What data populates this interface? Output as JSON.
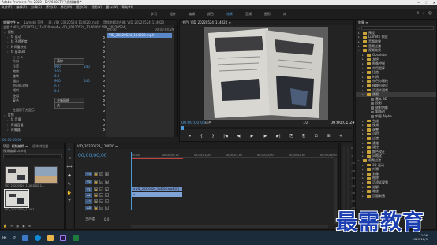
{
  "window": {
    "title": "Adobe Premiere Pro 2020 - D:\\Y630ST\\门\\视频编辑 *",
    "controls": [
      "—",
      "❐",
      "✕"
    ]
  },
  "menubar": {
    "items": [
      "文件(F)",
      "编辑(E)",
      "剪辑(C)",
      "序列(S)",
      "标记(M)",
      "图形(G)",
      "视图(V)",
      "窗口(W)",
      "帮助(H)"
    ]
  },
  "workspaces": {
    "items": [
      "学习",
      "组件",
      "编辑",
      "颜色",
      "效果",
      "音频",
      "图形",
      "库"
    ],
    "active_index": 4
  },
  "effect_controls": {
    "tabs": [
      "效果控件 ≡",
      "Lumetri 范围",
      "源: VID_20220524_114020.mp4",
      "音频剪辑混合器: VID_20220524_114020"
    ],
    "source_line": "主要 * VID_20220524_114020.mp4 ▸ VID_20220524_114020 * VID_20220524_...",
    "mini_timecode_start": "00:00",
    "mini_timecode_end": "00:00:04:29",
    "mini_clip_label": "VID_20220524_114020.mp4",
    "rows": [
      {
        "indent": 0,
        "label": "视频",
        "value": "",
        "value2": ""
      },
      {
        "indent": 1,
        "label": "fx 运动",
        "value": "",
        "value2": ""
      },
      {
        "indent": 1,
        "label": "fx 不透明度",
        "value": "",
        "value2": ""
      },
      {
        "indent": 1,
        "label": "时间重映射",
        "value": "",
        "value2": ""
      },
      {
        "indent": 1,
        "label": "fx 基本3D",
        "value": "",
        "value2": ""
      },
      {
        "indent": 2,
        "label": "○ □ ✎",
        "value": "",
        "value2": ""
      },
      {
        "indent": 2,
        "label": "方向",
        "dropdown": "清除",
        "value": "",
        "value2": ""
      },
      {
        "indent": 2,
        "label": "位置",
        "value": "960",
        "value2": "540"
      },
      {
        "indent": 2,
        "label": "缩放",
        "value": "100",
        "value2": ""
      },
      {
        "indent": 2,
        "label": "旋转",
        "value": "0.0",
        "value2": ""
      },
      {
        "indent": 2,
        "label": "锚点",
        "value": "960",
        "value2": "540"
      },
      {
        "indent": 2,
        "label": "防闪烁滤镜",
        "value": "0.0",
        "value2": ""
      },
      {
        "indent": 2,
        "label": "倾斜",
        "value": "0.0",
        "value2": ""
      },
      {
        "indent": 2,
        "label": "使用",
        "value": "",
        "value2": ""
      },
      {
        "indent": 2,
        "label": "复合",
        "dropdown": "全新网格",
        "value": "",
        "value2": ""
      },
      {
        "indent": 2,
        "label": "",
        "dropdown": "关",
        "value": "",
        "value2": ""
      },
      {
        "indent": 2,
        "label": "在图形下方显示",
        "value": "",
        "value2": ""
      },
      {
        "indent": 0,
        "label": "音频",
        "value": "",
        "value2": ""
      },
      {
        "indent": 1,
        "label": "fx 音量",
        "value": "",
        "value2": ""
      },
      {
        "indent": 1,
        "label": "声道音量",
        "value": "",
        "value2": ""
      },
      {
        "indent": 1,
        "label": "声像器",
        "value": "",
        "value2": ""
      }
    ],
    "bottom_timecode": "00:00:00:00"
  },
  "program_monitor": {
    "tab": "节目: VID_20220524_114020 ≡",
    "timecode_current": "00;00;00;00",
    "fit": "适合",
    "ratio": "1/2",
    "timecode_duration": "00;00;01;24",
    "transport": [
      "▾",
      "{",
      "}",
      "|◀",
      "◀|",
      "▶",
      "|▶",
      "▶|",
      "⎘",
      "⎗",
      "⊡",
      "⊞",
      "+"
    ]
  },
  "effects_panel": {
    "tab": "效果 ≡",
    "search_placeholder": "",
    "items": [
      {
        "indent": 0,
        "expanded": false,
        "name": "预设"
      },
      {
        "indent": 0,
        "expanded": false,
        "name": "Lumetri 预设"
      },
      {
        "indent": 0,
        "expanded": false,
        "name": "音频效果"
      },
      {
        "indent": 0,
        "expanded": false,
        "name": "音频过渡"
      },
      {
        "indent": 0,
        "expanded": true,
        "name": "视频效果"
      },
      {
        "indent": 1,
        "expanded": false,
        "name": "Obsolete"
      },
      {
        "indent": 1,
        "expanded": false,
        "name": "变换"
      },
      {
        "indent": 1,
        "expanded": false,
        "name": "图像控制"
      },
      {
        "indent": 1,
        "expanded": false,
        "name": "实用程序"
      },
      {
        "indent": 1,
        "expanded": false,
        "name": "扭曲"
      },
      {
        "indent": 1,
        "expanded": false,
        "name": "时间"
      },
      {
        "indent": 1,
        "expanded": false,
        "name": "杂色与颗粒"
      },
      {
        "indent": 1,
        "expanded": false,
        "name": "模糊与锐化"
      },
      {
        "indent": 1,
        "expanded": false,
        "name": "沉浸式视频"
      },
      {
        "indent": 1,
        "expanded": true,
        "name": "透视",
        "selected": true
      },
      {
        "indent": 2,
        "expanded": false,
        "name": "基本 3D"
      },
      {
        "indent": 2,
        "expanded": false,
        "name": "投影"
      },
      {
        "indent": 2,
        "expanded": false,
        "name": "放射阴影"
      },
      {
        "indent": 2,
        "expanded": false,
        "name": "斜角边"
      },
      {
        "indent": 2,
        "expanded": false,
        "name": "斜面 Alpha"
      },
      {
        "indent": 1,
        "expanded": false,
        "name": "生成"
      },
      {
        "indent": 1,
        "expanded": false,
        "name": "视频"
      },
      {
        "indent": 1,
        "expanded": false,
        "name": "调整"
      },
      {
        "indent": 1,
        "expanded": false,
        "name": "过时"
      },
      {
        "indent": 1,
        "expanded": false,
        "name": "过渡"
      },
      {
        "indent": 1,
        "expanded": false,
        "name": "通道"
      },
      {
        "indent": 1,
        "expanded": false,
        "name": "键控"
      },
      {
        "indent": 1,
        "expanded": false,
        "name": "颜色校正"
      },
      {
        "indent": 1,
        "expanded": false,
        "name": "风格化"
      },
      {
        "indent": 0,
        "expanded": false,
        "name": "视频过渡"
      },
      {
        "indent": 1,
        "expanded": false,
        "name": "3D 运动"
      },
      {
        "indent": 1,
        "expanded": false,
        "name": "内滑"
      },
      {
        "indent": 1,
        "expanded": false,
        "name": "划像"
      },
      {
        "indent": 1,
        "expanded": false,
        "name": "擦除"
      },
      {
        "indent": 1,
        "expanded": false,
        "name": "沉浸式视频"
      },
      {
        "indent": 1,
        "expanded": false,
        "name": "溶解"
      },
      {
        "indent": 1,
        "expanded": false,
        "name": "缩放"
      },
      {
        "indent": 1,
        "expanded": false,
        "name": "页面剥落"
      }
    ]
  },
  "project_panel": {
    "tabs": [
      "项目: 视频编辑 ≡",
      "媒体浏览器"
    ],
    "file_name": "视频编辑.prproj",
    "item_count": "",
    "items": [
      {
        "label": "VID_20220524_11402...",
        "duration": "4:29"
      },
      {
        "label": "VID_2...",
        "duration": ""
      },
      {
        "label": "VID_20220524_11402...",
        "duration": "4:29"
      }
    ]
  },
  "tools": [
    "▸",
    "⇥",
    "⟺",
    "◆",
    "✎",
    "✋",
    "T"
  ],
  "timeline": {
    "tab": "VID_20220524_114020 ≡",
    "timecode": "00;00;00;00",
    "ruler_labels": [
      ":00;00",
      "00;00;00;30",
      "00;00;01;00",
      "00;00;01;30",
      "00;00;02;00",
      "00;00;02;30",
      "00;00;03;00"
    ],
    "video_tracks": [
      "V3",
      "V2",
      "V1"
    ],
    "audio_tracks": [
      "A1",
      "A2",
      "A3"
    ],
    "video_clip": "fx VID_20220524_114020.mp4 [V]",
    "audio_clip": "fx",
    "master_label": "主声道",
    "master_value": "0.0"
  },
  "audio_meter": {
    "db_labels": [
      "0",
      "-6",
      "-12",
      "-18",
      "-24",
      "-30",
      "-36",
      "-42",
      "-48",
      "-54"
    ]
  },
  "taskbar": {
    "time": "12:06",
    "date": "2021/12/9"
  },
  "watermark": {
    "text": "最需教育"
  },
  "colors": {
    "accent": "#4a9ad6",
    "clip_video": "#6d8fc4",
    "clip_audio": "#7fa3d4",
    "watermark": "#1b3fb0"
  }
}
